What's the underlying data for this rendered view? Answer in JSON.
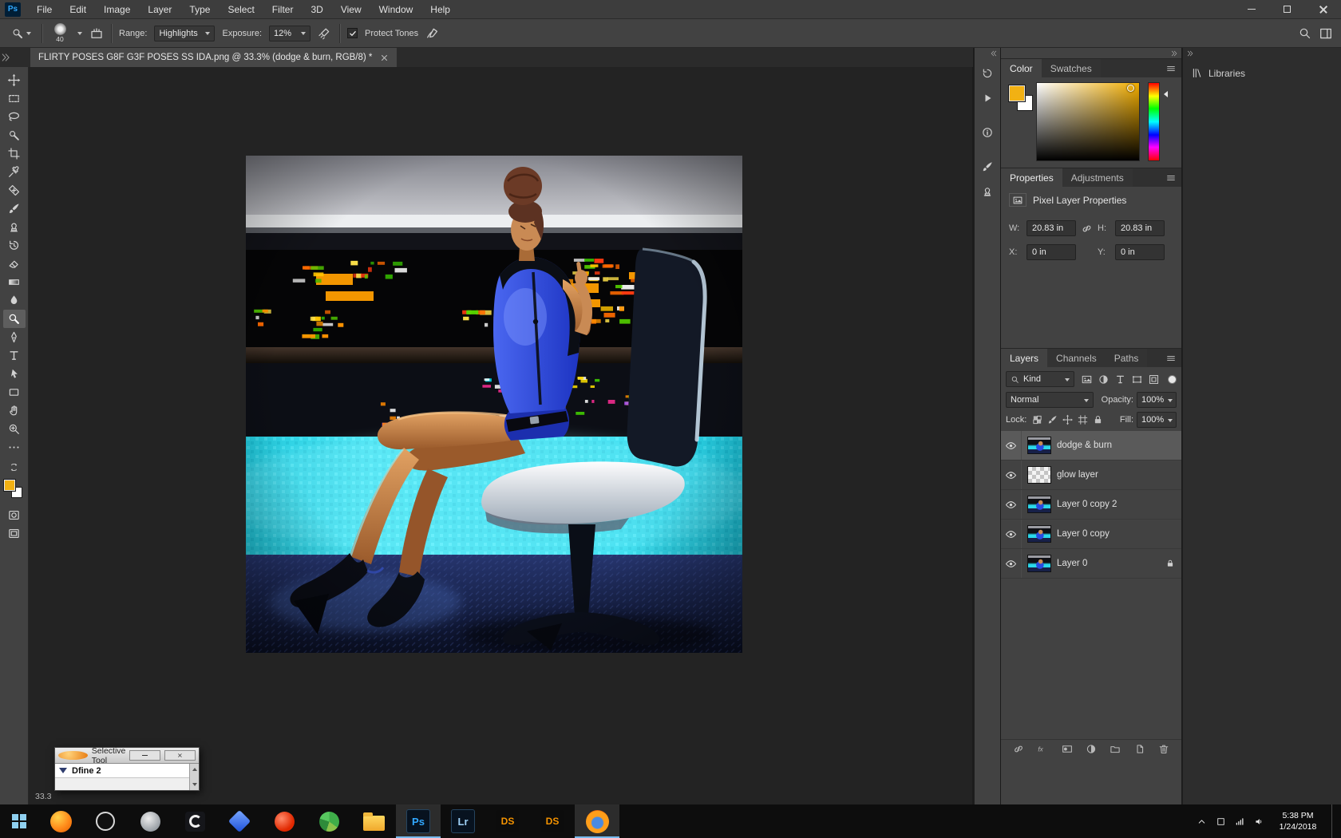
{
  "app": {
    "logo": "Ps"
  },
  "menubar": {
    "items": [
      "File",
      "Edit",
      "Image",
      "Layer",
      "Type",
      "Select",
      "Filter",
      "3D",
      "View",
      "Window",
      "Help"
    ]
  },
  "options_bar": {
    "brush_size": "40",
    "range_label": "Range:",
    "range_value": "Highlights",
    "exposure_label": "Exposure:",
    "exposure_value": "12%",
    "protect_tones_label": "Protect Tones"
  },
  "document_tab": {
    "title": "FLIRTY POSES G8F G3F POSES SS IDA.png @ 33.3% (dodge & burn, RGB/8) *"
  },
  "toolbar": {
    "tools": [
      "move",
      "marquee",
      "lasso",
      "quick-selection",
      "crop",
      "eyedropper",
      "spot-healing",
      "brush",
      "clone-stamp",
      "history-brush",
      "eraser",
      "gradient",
      "blur",
      "dodge",
      "pen",
      "type",
      "path-selection",
      "shape",
      "hand",
      "zoom",
      "ellipsis"
    ],
    "selected": "dodge",
    "foreground_color": "#F2B113",
    "background_color": "#FFFFFF"
  },
  "dock": {
    "panel_icons": [
      "history",
      "actions",
      "info",
      "brush-settings",
      "clone-source"
    ]
  },
  "panels": {
    "color": {
      "tabs": [
        "Color",
        "Swatches"
      ]
    },
    "properties": {
      "tabs": [
        "Properties",
        "Adjustments"
      ],
      "header": "Pixel Layer Properties",
      "w_label": "W:",
      "w_value": "20.83 in",
      "h_label": "H:",
      "h_value": "20.83 in",
      "x_label": "X:",
      "x_value": "0 in",
      "y_label": "Y:",
      "y_value": "0 in"
    },
    "layers": {
      "tabs": [
        "Layers",
        "Channels",
        "Paths"
      ],
      "kind_value": "Kind",
      "filter_icons": [
        "pixel-filter",
        "adjustment-filter",
        "type-filter",
        "shape-filter",
        "smart-filter"
      ],
      "blend_mode": "Normal",
      "opacity_label": "Opacity:",
      "opacity_value": "100%",
      "lock_label": "Lock:",
      "lock_icons": [
        "lock-transparent",
        "lock-pixels",
        "lock-position",
        "lock-artboard",
        "lock-all"
      ],
      "fill_label": "Fill:",
      "fill_value": "100%",
      "fx_label": "fx",
      "bottom_icons": [
        "link-layers",
        "layer-effects",
        "layer-mask",
        "adjustment-layer",
        "layer-group",
        "new-layer",
        "delete-layer"
      ],
      "items": [
        {
          "name": "dodge & burn",
          "selected": true,
          "thumb": "image"
        },
        {
          "name": "glow layer",
          "selected": false,
          "thumb": "checker"
        },
        {
          "name": "Layer 0 copy 2",
          "selected": false,
          "thumb": "image"
        },
        {
          "name": "Layer 0 copy",
          "selected": false,
          "thumb": "image"
        },
        {
          "name": "Layer 0",
          "selected": false,
          "thumb": "image",
          "locked": true
        }
      ]
    },
    "libraries": {
      "label": "Libraries"
    }
  },
  "floating_panel": {
    "title": "Selective Tool",
    "item": "Dfine 2"
  },
  "status_bar": {
    "zoom": "33.3"
  },
  "taskbar": {
    "time": "5:38 PM",
    "date": "1/24/2018",
    "apps": [
      {
        "name": "start"
      },
      {
        "name": "browser-orange"
      },
      {
        "name": "recorder"
      },
      {
        "name": "app-gray"
      },
      {
        "name": "app-c"
      },
      {
        "name": "app-blue-gem"
      },
      {
        "name": "app-red"
      },
      {
        "name": "app-green"
      },
      {
        "name": "file-explorer"
      },
      {
        "name": "photoshop",
        "label": "Ps",
        "active": true
      },
      {
        "name": "lightroom",
        "label": "Lr"
      },
      {
        "name": "daz-studio",
        "label": "DS"
      },
      {
        "name": "daz-studio-2",
        "label": "DS"
      },
      {
        "name": "firefox",
        "active": true
      }
    ]
  }
}
